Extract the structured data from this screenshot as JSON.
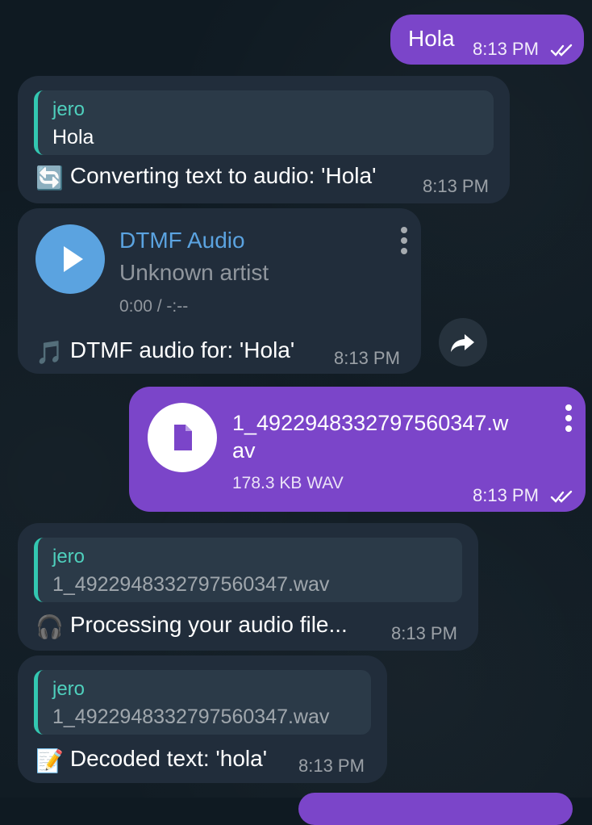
{
  "messages": {
    "m1": {
      "text": "Hola",
      "time": "8:13 PM"
    },
    "m2": {
      "reply_name": "jero",
      "reply_text": "Hola",
      "emoji": "🔄",
      "text": "Converting text to audio: 'Hola'",
      "time": "8:13 PM"
    },
    "m3": {
      "title": "DTMF Audio",
      "artist": "Unknown artist",
      "duration": "0:00 / -:--",
      "emoji": "🎵",
      "text": "DTMF audio for: 'Hola'",
      "time": "8:13 PM"
    },
    "m4": {
      "filename_line1": "1_4922948332797560347.w",
      "filename_line2": "av",
      "meta": "178.3 KB WAV",
      "time": "8:13 PM"
    },
    "m5": {
      "reply_name": "jero",
      "reply_text": "1_4922948332797560347.wav",
      "emoji": "🎧",
      "text": "Processing your audio file...",
      "time": "8:13 PM"
    },
    "m6": {
      "reply_name": "jero",
      "reply_text": "1_4922948332797560347.wav",
      "emoji": "📝",
      "text": "Decoded text: 'hola'",
      "time": "8:13 PM"
    }
  },
  "colors": {
    "incoming": "#212d3b",
    "outgoing": "#7b45c9",
    "accent_teal": "#4fd0bd",
    "accent_blue": "#5ba3e0",
    "background": "#0f1a22"
  },
  "icons": [
    "double-check-icon",
    "play-icon",
    "more-vert-icon",
    "share-icon",
    "file-icon"
  ]
}
